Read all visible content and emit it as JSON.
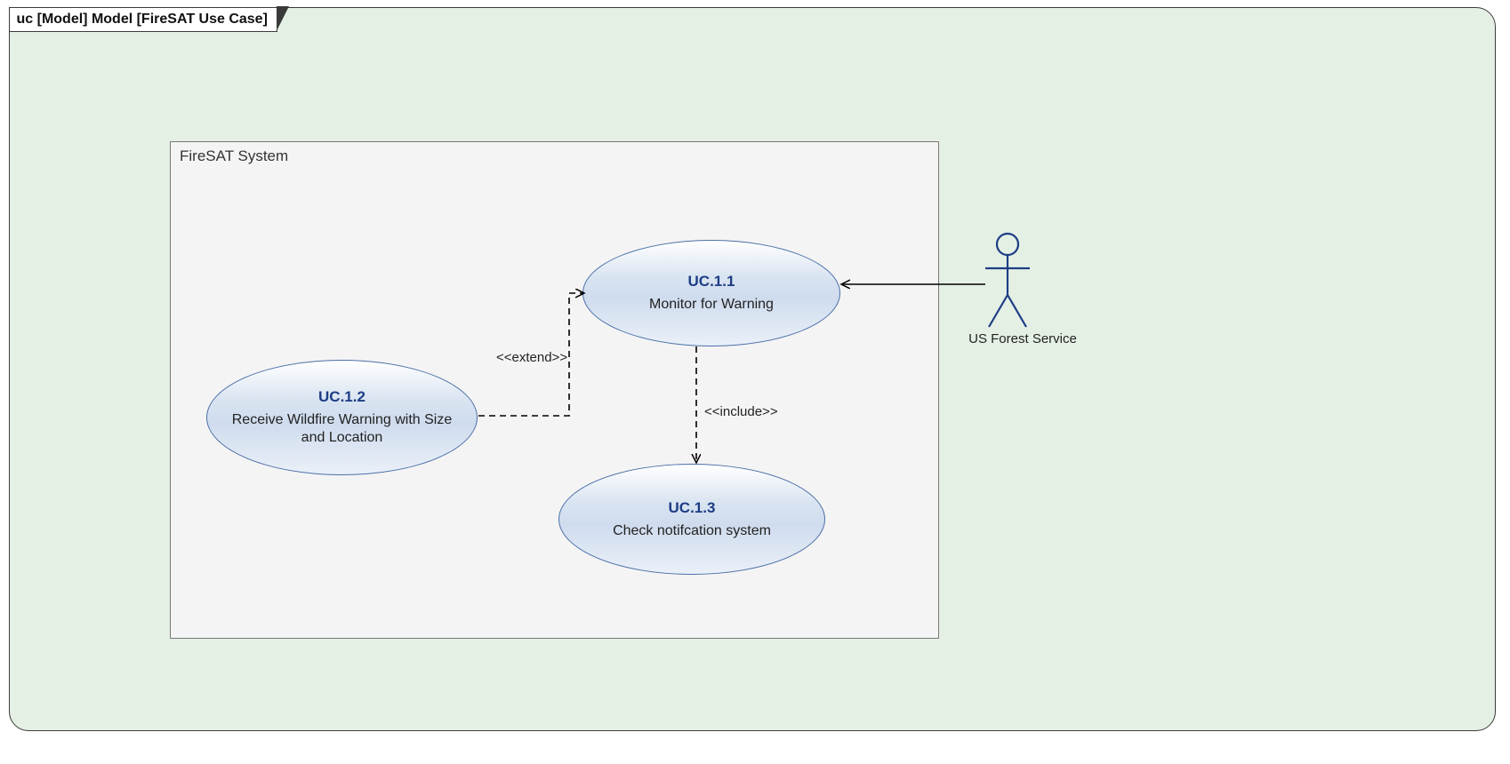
{
  "frame": {
    "header": "uc [Model] Model [FireSAT Use Case]"
  },
  "system": {
    "title": "FireSAT System"
  },
  "usecases": {
    "uc11": {
      "id": "UC.1.1",
      "name": "Monitor for Warning"
    },
    "uc12": {
      "id": "UC.1.2",
      "name": "Receive Wildfire Warning with Size and Location"
    },
    "uc13": {
      "id": "UC.1.3",
      "name": "Check notifcation system"
    }
  },
  "relationships": {
    "extend": "<<extend>>",
    "include": "<<include>>"
  },
  "actor": {
    "name": "US Forest Service"
  }
}
